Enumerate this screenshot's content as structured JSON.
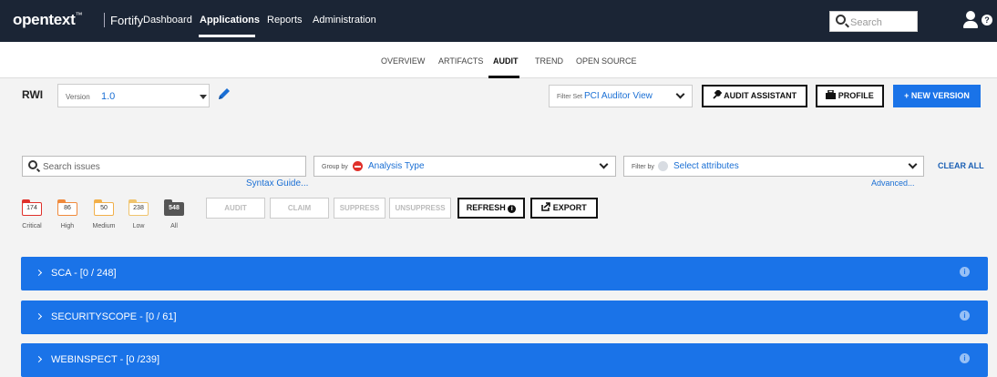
{
  "header": {
    "logo": "opentext",
    "logo_mark": "™",
    "product": "Fortify",
    "nav": [
      {
        "label": "Dashboard",
        "active": false
      },
      {
        "label": "Applications",
        "active": true
      },
      {
        "label": "Reports",
        "active": false
      },
      {
        "label": "Administration",
        "active": false
      }
    ],
    "search_placeholder": "Search"
  },
  "subtabs": [
    {
      "label": "OVERVIEW",
      "active": false
    },
    {
      "label": "ARTIFACTS",
      "active": false
    },
    {
      "label": "AUDIT",
      "active": true
    },
    {
      "label": "TREND",
      "active": false
    },
    {
      "label": "OPEN SOURCE",
      "active": false
    }
  ],
  "app": {
    "name": "RWI",
    "version_label": "Version",
    "version_value": "1.0"
  },
  "toolbar": {
    "filter_set_label": "Filter Set",
    "filter_set_value": "PCI Auditor View",
    "audit_assistant": "AUDIT ASSISTANT",
    "profile": "PROFILE",
    "new_version": "+ NEW VERSION"
  },
  "filters": {
    "search_placeholder": "Search issues",
    "syntax_guide": "Syntax Guide...",
    "group_by_label": "Group by",
    "group_by_value": "Analysis Type",
    "filter_by_label": "Filter by",
    "filter_by_value": "Select attributes",
    "clear_all": "CLEAR ALL",
    "advanced": "Advanced..."
  },
  "severity": [
    {
      "label": "Critical",
      "count": "174",
      "color": "#e0302a"
    },
    {
      "label": "High",
      "count": "86",
      "color": "#f08a3c"
    },
    {
      "label": "Medium",
      "count": "50",
      "color": "#f2b04a"
    },
    {
      "label": "Low",
      "count": "238",
      "color": "#f0c46e"
    },
    {
      "label": "All",
      "count": "548",
      "color": "#555555"
    }
  ],
  "actions": {
    "audit": "AUDIT",
    "claim": "CLAIM",
    "suppress": "SUPPRESS",
    "unsuppress": "UNSUPPRESS",
    "refresh": "REFRESH",
    "export": "EXPORT"
  },
  "groups": [
    {
      "title": "SCA - [0 / 248]"
    },
    {
      "title": "SECURITYSCOPE - [0 / 61]"
    },
    {
      "title": "WEBINSPECT - [0 /239]"
    }
  ],
  "colors": {
    "header_bg": "#1b2535",
    "accent": "#1a73e8",
    "link": "#1a6fd4"
  }
}
